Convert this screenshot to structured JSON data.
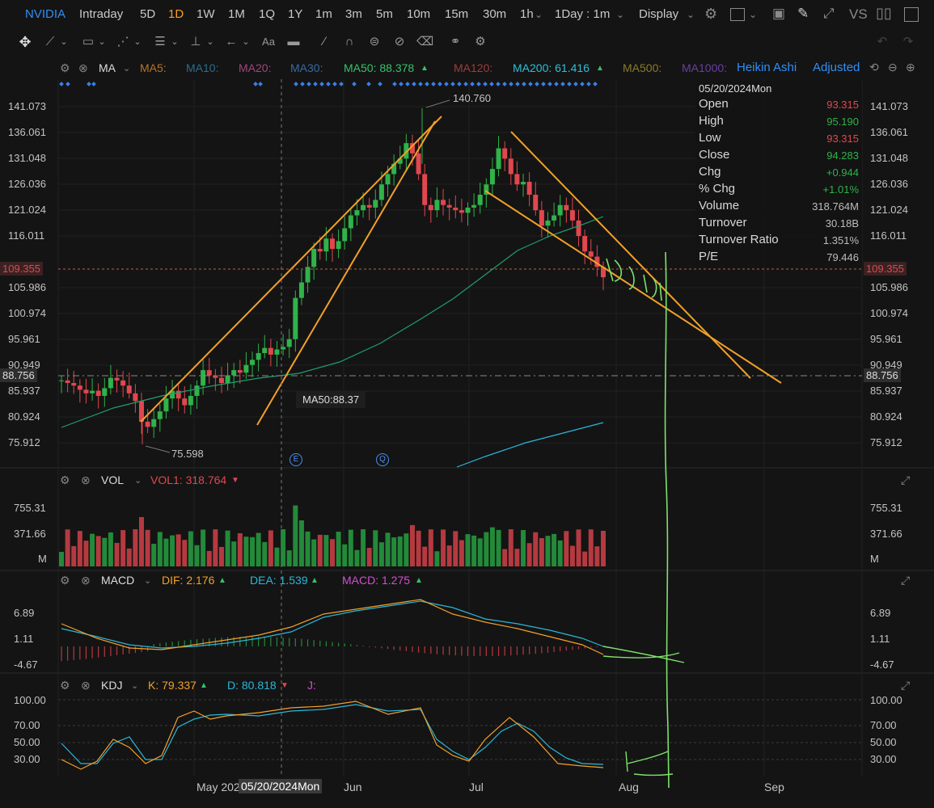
{
  "toolbar": {
    "symbol": "NVIDIA",
    "periods": [
      "Intraday",
      "5D",
      "1D",
      "1W",
      "1M",
      "1Q",
      "1Y",
      "1m",
      "3m",
      "5m",
      "10m",
      "15m",
      "30m",
      "1h"
    ],
    "active_period": "1D",
    "interval_select": "1Day : 1m",
    "display": "Display",
    "vs": "VS"
  },
  "main": {
    "ma_legend": {
      "ma_label": "MA",
      "ma5": "MA5:",
      "ma10": "MA10:",
      "ma20": "MA20:",
      "ma30": "MA30:",
      "ma50": "MA50: 88.378",
      "ma120": "MA120:",
      "ma200": "MA200: 61.416",
      "ma500": "MA500:",
      "ma1000": "MA1000:",
      "heikin": "Heikin Ashi",
      "adjusted": "Adjusted"
    },
    "y_ticks": [
      "141.073",
      "136.061",
      "131.048",
      "126.036",
      "121.024",
      "116.011",
      "105.986",
      "100.974",
      "95.961",
      "90.949",
      "85.937",
      "80.924",
      "75.912"
    ],
    "high_label": "140.760",
    "low_label": "75.598",
    "crosshair_price": "109.355",
    "dash_price": "88.756",
    "ma50_tooltip": "MA50:88.37",
    "event_e": "E",
    "event_q": "Q"
  },
  "info": {
    "date": "05/20/2024Mon",
    "rows": [
      {
        "label": "Open",
        "value": "93.315",
        "color": "#e0474f"
      },
      {
        "label": "High",
        "value": "95.190",
        "color": "#2fb34a"
      },
      {
        "label": "Low",
        "value": "93.315",
        "color": "#e0474f"
      },
      {
        "label": "Close",
        "value": "94.283",
        "color": "#2fb34a"
      },
      {
        "label": "Chg",
        "value": "+0.944",
        "color": "#2fb34a"
      },
      {
        "label": "% Chg",
        "value": "+1.01%",
        "color": "#2fb34a"
      },
      {
        "label": "Volume",
        "value": "318.764M",
        "color": "#bdbdbd"
      },
      {
        "label": "Turnover",
        "value": "30.18B",
        "color": "#bdbdbd"
      },
      {
        "label": "Turnover Ratio",
        "value": "1.351%",
        "color": "#bdbdbd"
      },
      {
        "label": "P/E",
        "value": "79.446",
        "color": "#bdbdbd"
      }
    ]
  },
  "volume": {
    "title": "VOL",
    "vol1": "VOL1: 318.764",
    "ticks": [
      "755.31",
      "371.66",
      "M"
    ]
  },
  "macd": {
    "title": "MACD",
    "dif": "DIF: 2.176",
    "dea": "DEA: 1.539",
    "macd": "MACD: 1.275",
    "ticks": [
      "6.89",
      "1.11",
      "-4.67"
    ]
  },
  "kdj": {
    "title": "KDJ",
    "k": "K: 79.337",
    "d": "D: 80.818",
    "j": "J:",
    "ticks": [
      "100.00",
      "70.00",
      "50.00",
      "30.00"
    ]
  },
  "x_axis": {
    "labels": [
      "May 2024",
      "Jun",
      "Jul",
      "Aug",
      "Sep"
    ],
    "cursor_date": "05/20/2024Mon"
  },
  "colors": {
    "up": "#2fb34a",
    "down": "#e0474f",
    "accent": "#2f8ff7",
    "trend": "#f3a028",
    "ma50": "#1f9e6e",
    "ma200": "#2bb7d8",
    "draw": "#7ee26a"
  }
}
